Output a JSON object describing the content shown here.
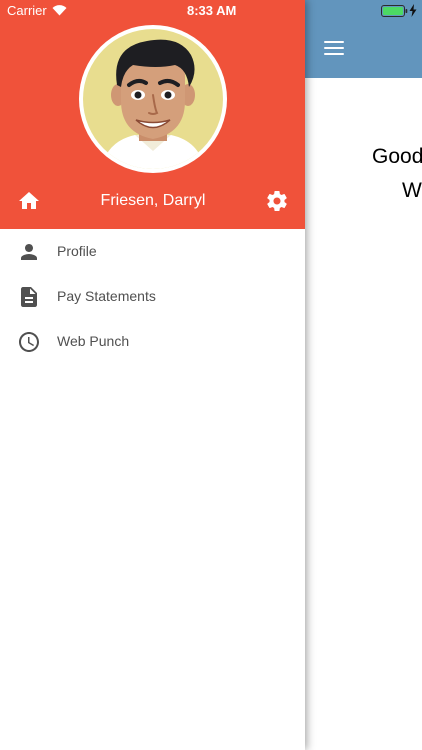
{
  "status_bar": {
    "carrier": "Carrier",
    "time": "8:33 AM"
  },
  "drawer": {
    "user_name": "Friesen, Darryl",
    "header_color": "#f0523a",
    "items": [
      {
        "label": "Profile",
        "icon": "person-icon"
      },
      {
        "label": "Pay Statements",
        "icon": "document-icon"
      },
      {
        "label": "Web Punch",
        "icon": "clock-icon"
      }
    ]
  },
  "main": {
    "appbar_color": "#6295bd",
    "greeting_partial": "Good",
    "subtitle_partial": "We"
  }
}
